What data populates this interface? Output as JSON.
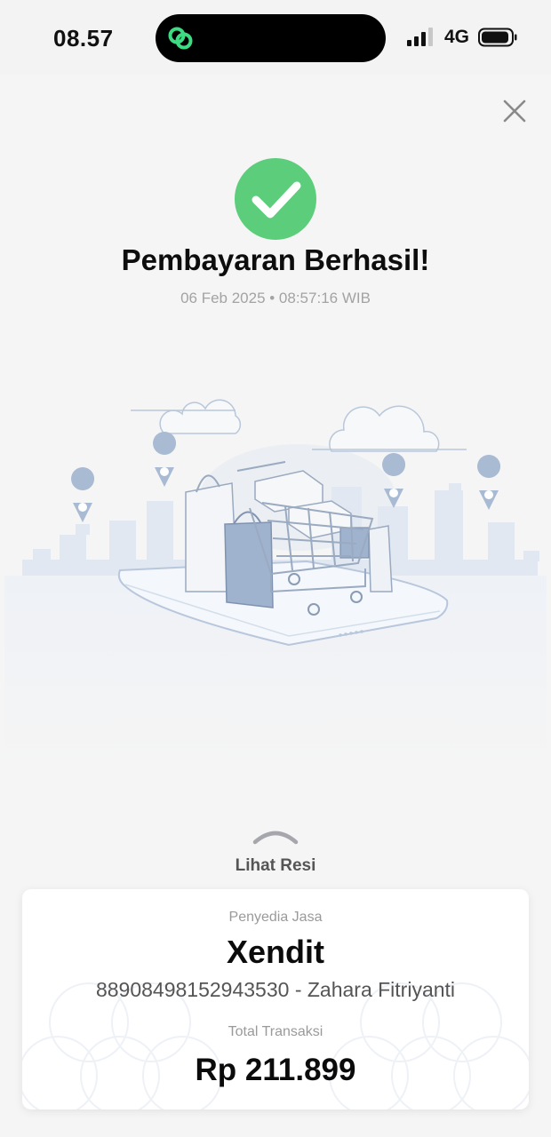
{
  "status_bar": {
    "time": "08.57",
    "network": "4G"
  },
  "header": {
    "title": "Pembayaran Berhasil!",
    "datetime": "06 Feb 2025 • 08:57:16 WIB"
  },
  "receipt": {
    "toggle_label": "Lihat Resi",
    "provider_label": "Penyedia Jasa",
    "provider_name": "Xendit",
    "account_line": "88908498152943530 - Zahara Fitriyanti",
    "total_label": "Total Transaksi",
    "total_amount": "Rp 211.899"
  },
  "colors": {
    "success_green": "#5ccd7a",
    "island_logo_green": "#3ddc84",
    "illustration_blue": "#9fb3cf",
    "background": "#f5f5f5"
  },
  "icons": {
    "close": "close-icon",
    "success": "check-circle-icon",
    "expand": "chevron-up-icon",
    "app_logo": "link-icon"
  }
}
